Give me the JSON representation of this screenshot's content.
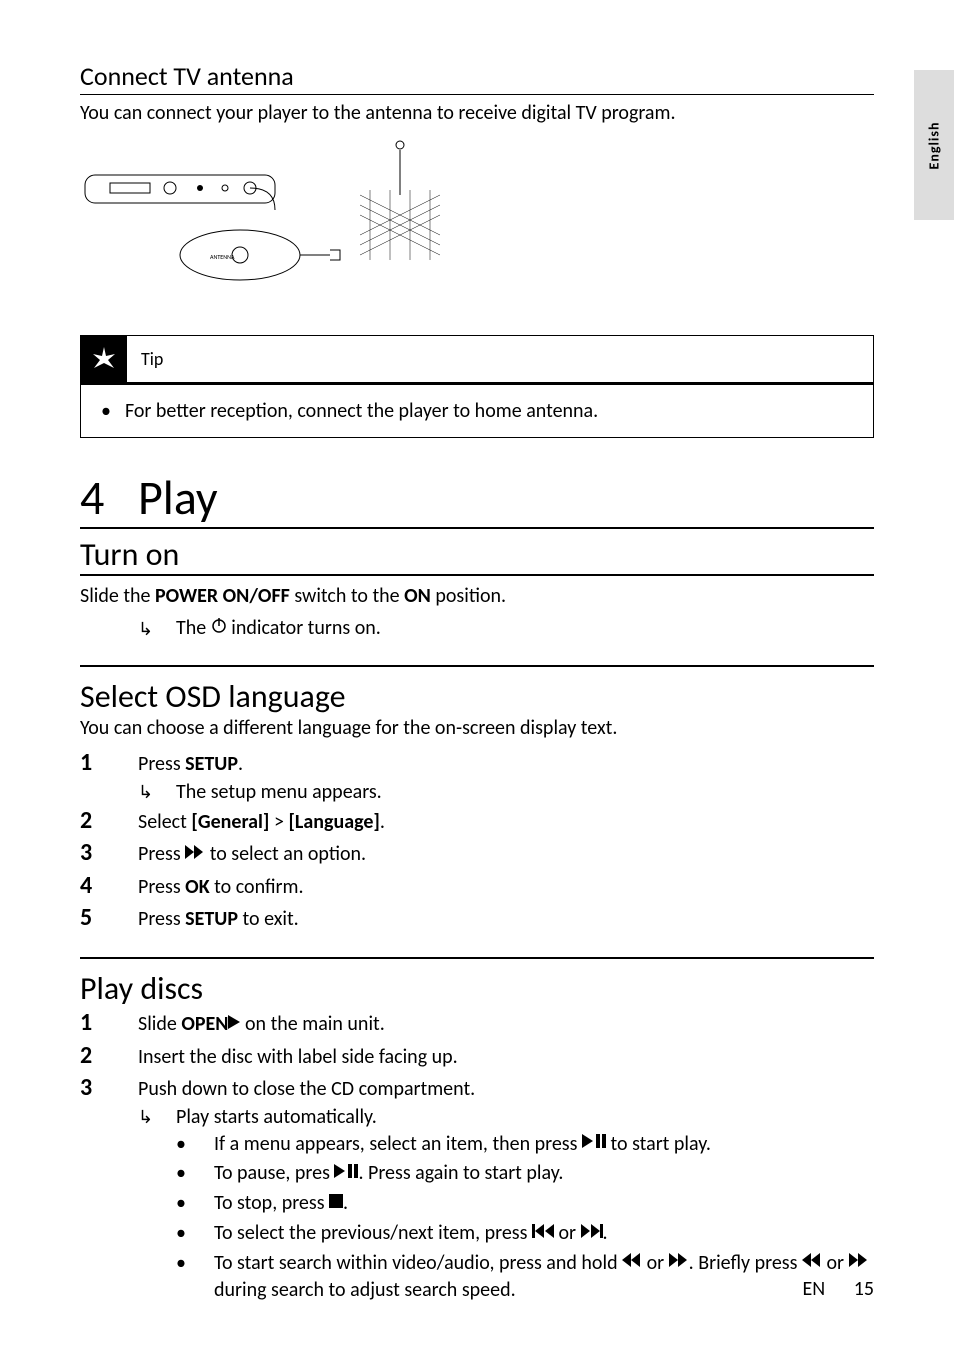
{
  "langTab": "English",
  "section1": {
    "heading": "Connect TV antenna",
    "intro": "You can connect your player to the antenna to receive digital TV program.",
    "diagramLabel": "ANTENNA"
  },
  "tip": {
    "label": "Tip",
    "text": "For better reception, connect the player to home antenna."
  },
  "chapter": {
    "num": "4",
    "title": "Play"
  },
  "turnOn": {
    "heading": "Turn on",
    "line1_a": "Slide the ",
    "line1_b": "POWER ON/OFF",
    "line1_c": " switch to the ",
    "line1_d": "ON",
    "line1_e": " position.",
    "result_a": "The ",
    "result_b": " indicator turns on."
  },
  "osd": {
    "heading": "Select OSD language",
    "intro": "You can choose a different language for the on-screen display text.",
    "s1_a": "Press ",
    "s1_b": "SETUP",
    "s1_c": ".",
    "s1_result": "The setup menu appears.",
    "s2_a": "Select ",
    "s2_b": "[General]",
    "s2_c": " > ",
    "s2_d": "[Language]",
    "s2_e": ".",
    "s3_a": "Press ",
    "s3_b": " to select an option.",
    "s4_a": "Press ",
    "s4_b": "OK",
    "s4_c": " to confirm.",
    "s5_a": "Press ",
    "s5_b": "SETUP",
    "s5_c": " to exit."
  },
  "discs": {
    "heading": "Play discs",
    "s1_a": "Slide ",
    "s1_b": "OPEN",
    "s1_c": " on the main unit.",
    "s2": "Insert the disc with label side facing up.",
    "s3": "Push down to close the CD compartment.",
    "s3_result": "Play starts automatically.",
    "b1_a": "If a menu appears, select an item, then press ",
    "b1_b": " to start play.",
    "b2_a": "To pause, pres ",
    "b2_b": ". Press again to start play.",
    "b3_a": "To stop, press ",
    "b3_b": ".",
    "b4_a": "To select the previous/next item, press ",
    "b4_b": " or ",
    "b4_c": ".",
    "b5_a": "To start search within video/audio, press and hold ",
    "b5_b": " or ",
    "b5_c": ". Briefly press ",
    "b5_d": " or ",
    "b5_e": " during search to adjust search speed."
  },
  "footer": {
    "lang": "EN",
    "page": "15"
  }
}
